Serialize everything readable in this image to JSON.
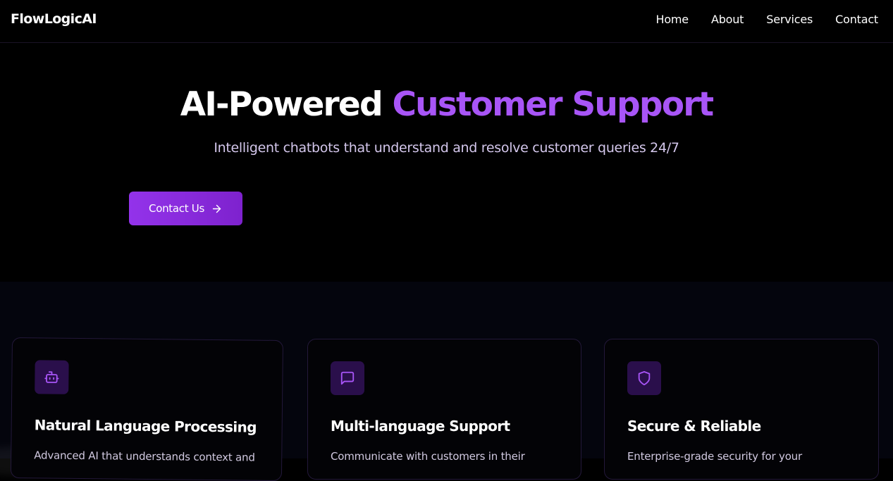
{
  "brand": "FlowLogicAI",
  "nav": {
    "links": [
      "Home",
      "About",
      "Services",
      "Contact"
    ]
  },
  "hero": {
    "title_plain": "AI-Powered",
    "title_highlight": "Customer Support",
    "subtitle": "Intelligent chatbots that understand and resolve customer queries 24/7",
    "cta_label": "Contact Us",
    "cta_icon": "arrow-right-icon"
  },
  "features": [
    {
      "icon": "bot-icon",
      "title": "Natural Language Processing",
      "description": "Advanced AI that understands context and"
    },
    {
      "icon": "message-square-icon",
      "title": "Multi-language Support",
      "description": "Communicate with customers in their"
    },
    {
      "icon": "shield-icon",
      "title": "Secure & Reliable",
      "description": "Enterprise-grade security for your"
    }
  ],
  "colors": {
    "accent": "#a855f7",
    "button_start": "#9333ea",
    "button_end": "#7e22ce",
    "icon_bg": "#2a0f4b",
    "page_bg": "#000000",
    "section_bg": "#04050d"
  }
}
